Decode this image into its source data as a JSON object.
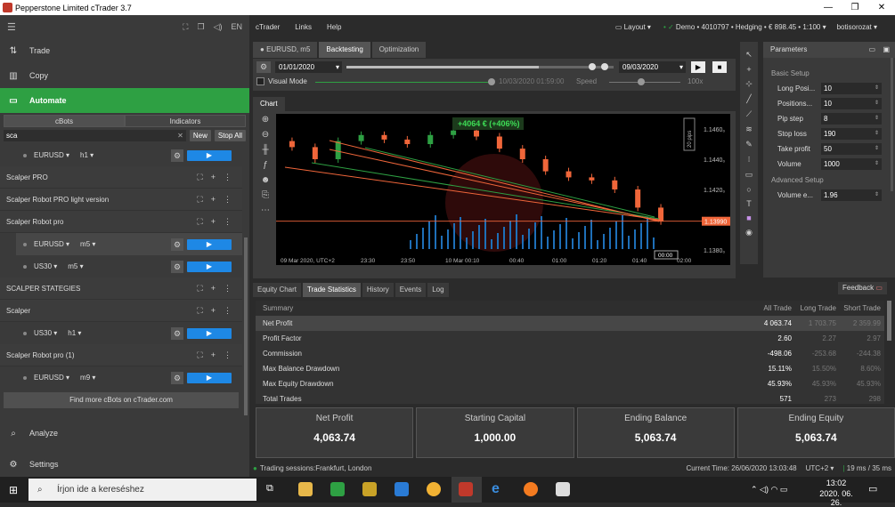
{
  "window": {
    "title": "Pepperstone Limited cTrader 3.7",
    "min": "—",
    "max": "❐",
    "close": "✕"
  },
  "topbar": {
    "menus": [
      "cTrader",
      "Links",
      "Help"
    ],
    "layout": "Layout",
    "account": "Demo • 4010797 • Hedging • € 898.45 • 1:100",
    "user": "botisorozat"
  },
  "sidebar": {
    "trade": "Trade",
    "copy": "Copy",
    "automate": "Automate",
    "analyze": "Analyze",
    "settings": "Settings",
    "tab_cbots": "cBots",
    "tab_indicators": "Indicators",
    "search_value": "sca",
    "new_btn": "New",
    "stopall_btn": "Stop All",
    "find_more": "Find more cBots on cTrader.com",
    "rows": [
      {
        "type": "inst",
        "symbol": "EURUSD",
        "tf": "h1",
        "selected": false
      },
      {
        "type": "bot",
        "name": "Scalper PRO"
      },
      {
        "type": "bot",
        "name": "Scalper Robot PRO light version"
      },
      {
        "type": "bot",
        "name": "Scalper Robot pro"
      },
      {
        "type": "inst",
        "symbol": "EURUSD",
        "tf": "m5",
        "selected": true
      },
      {
        "type": "inst",
        "symbol": "US30",
        "tf": "m5",
        "selected": false
      },
      {
        "type": "bot",
        "name": "SCALPER STATEGIES"
      },
      {
        "type": "bot",
        "name": "Scalper"
      },
      {
        "type": "inst",
        "symbol": "US30",
        "tf": "h1",
        "selected": false
      },
      {
        "type": "bot",
        "name": "Scalper Robot pro (1)"
      },
      {
        "type": "inst",
        "symbol": "EURUSD",
        "tf": "m9",
        "selected": false
      }
    ]
  },
  "tabs": {
    "symbol": "EURUSD, m5",
    "backtesting": "Backtesting",
    "optimization": "Optimization"
  },
  "backtest": {
    "from": "01/01/2020",
    "to": "09/03/2020",
    "visual_mode": "Visual Mode",
    "current": "10/03/2020 01:59:00",
    "speed": "Speed",
    "speed_val": "100x",
    "progress": 0.72,
    "speed_level": 0.33
  },
  "chart": {
    "tab": "Chart",
    "pnl": "+4064 € (+406%)",
    "pips_label": "20 pips",
    "price_tag": "1.13990",
    "y_ticks": [
      "1.1460₀",
      "1.1440₀",
      "1.1420₀",
      "1.1380₀"
    ],
    "x_ticks": [
      "09 Mar 2020, UTC+2",
      "23:30",
      "23:50",
      "10 Mar 00:10",
      "00:40",
      "01:00",
      "01:20",
      "01:40",
      "02:00"
    ],
    "cursor_time": "00:00"
  },
  "chart_data": {
    "type": "candlestick",
    "title": "",
    "x": [
      "23:10",
      "23:20",
      "23:30",
      "23:40",
      "23:50",
      "00:00",
      "00:10",
      "00:20",
      "00:30",
      "00:40",
      "00:50",
      "01:00",
      "01:10",
      "01:20",
      "01:30",
      "01:40",
      "01:50"
    ],
    "close": [
      1.1448,
      1.144,
      1.1452,
      1.1456,
      1.1453,
      1.145,
      1.1456,
      1.1459,
      1.1455,
      1.1447,
      1.144,
      1.1432,
      1.1428,
      1.1426,
      1.142,
      1.1408,
      1.1399
    ],
    "ylim": [
      1.137,
      1.147
    ]
  },
  "params": {
    "title": "Parameters",
    "basic": "Basic Setup",
    "advanced": "Advanced Setup",
    "items": [
      {
        "label": "Long Posi...",
        "value": "10"
      },
      {
        "label": "Positions...",
        "value": "10"
      },
      {
        "label": "Pip step",
        "value": "8"
      },
      {
        "label": "Stop loss",
        "value": "190"
      },
      {
        "label": "Take profit",
        "value": "50"
      },
      {
        "label": "Volume",
        "value": "1000"
      }
    ],
    "adv": [
      {
        "label": "Volume e...",
        "value": "1.96"
      }
    ]
  },
  "bottom_tabs": [
    "Equity Chart",
    "Trade Statistics",
    "History",
    "Events",
    "Log"
  ],
  "feedback": "Feedback",
  "stats": {
    "headers": [
      "Summary",
      "All Trade",
      "Long Trade",
      "Short Trade"
    ],
    "rows": [
      [
        "Net Profit",
        "4 063.74",
        "1 703.75",
        "2 359.99"
      ],
      [
        "Profit Factor",
        "2.60",
        "2.27",
        "2.97"
      ],
      [
        "Commission",
        "-498.06",
        "-253.68",
        "-244.38"
      ],
      [
        "Max Balance Drawdown",
        "15.11%",
        "15.50%",
        "8.60%"
      ],
      [
        "Max Equity Drawdown",
        "45.93%",
        "45.93%",
        "45.93%"
      ],
      [
        "Total Trades",
        "571",
        "273",
        "298"
      ]
    ]
  },
  "cards": [
    {
      "title": "Net Profit",
      "value": "4,063.74"
    },
    {
      "title": "Starting Capital",
      "value": "1,000.00"
    },
    {
      "title": "Ending Balance",
      "value": "5,063.74"
    },
    {
      "title": "Ending Equity",
      "value": "5,063.74"
    }
  ],
  "status": {
    "sessions": "Trading sessions:Frankfurt, London",
    "time": "Current Time: 26/06/2020 13:03:48",
    "tz": "UTC+2",
    "latency": "19 ms / 35 ms"
  },
  "taskbar": {
    "search": "Írjon ide a kereséshez",
    "clock": "13:02",
    "date": "2020. 06. 26."
  }
}
